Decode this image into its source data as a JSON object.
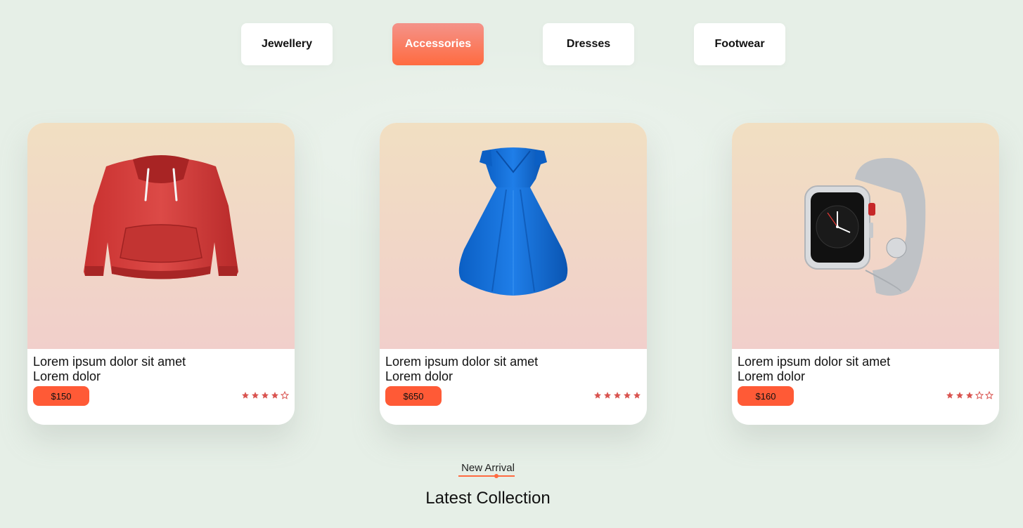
{
  "tabs": [
    {
      "label": "Jewellery",
      "active": false
    },
    {
      "label": "Accessories",
      "active": true
    },
    {
      "label": "Dresses",
      "active": false
    },
    {
      "label": "Footwear",
      "active": false
    }
  ],
  "products": [
    {
      "title_line1": "Lorem ipsum dolor sit amet",
      "title_line2": "Lorem dolor",
      "price": "$150",
      "rating": 4,
      "image_icon": "red-hoodie-icon"
    },
    {
      "title_line1": "Lorem ipsum dolor sit amet",
      "title_line2": "Lorem dolor",
      "price": "$650",
      "rating": 5,
      "image_icon": "blue-dress-icon"
    },
    {
      "title_line1": "Lorem ipsum dolor sit amet",
      "title_line2": "Lorem dolor",
      "price": "$160",
      "rating": 3,
      "image_icon": "smartwatch-icon"
    }
  ],
  "section": {
    "subtitle": "New Arrival",
    "title": "Latest Collection"
  },
  "colors": {
    "accent": "#ff5a36",
    "star": "#d9534f",
    "background": "#e6efe7"
  }
}
